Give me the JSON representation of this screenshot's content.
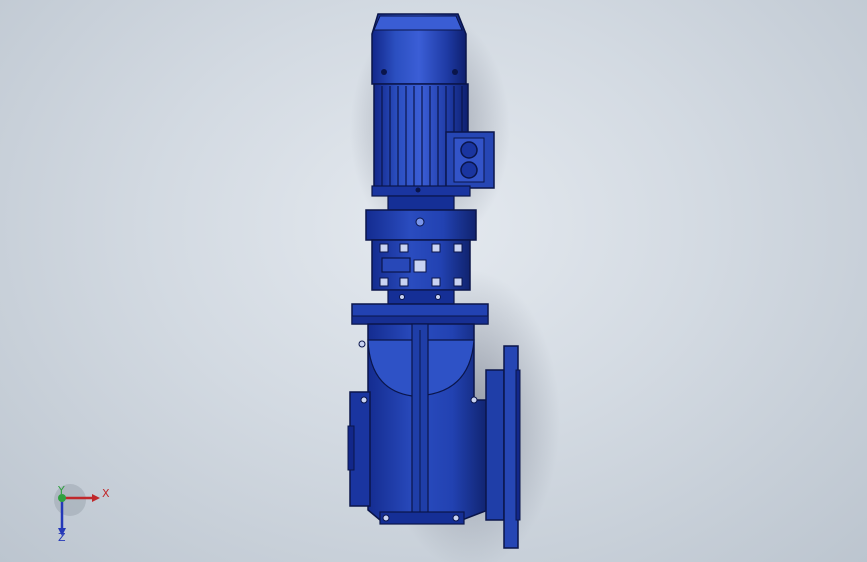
{
  "viewport": {
    "background": [
      "#e4e9ef",
      "#bcc5cf"
    ]
  },
  "model": {
    "name": "gear-motor",
    "colors": {
      "body": "#1f3ea8",
      "body_dark": "#0f2270",
      "body_mid": "#2b4fc0",
      "body_light": "#4d6fdc",
      "highlight": "#7a96ea",
      "outline": "#0a154a",
      "shadow": "#5a6070"
    }
  },
  "triad": {
    "x_label": "X",
    "y_label": "Y",
    "z_label": "Z",
    "x_color": "#c0282b",
    "y_color": "#2fa040",
    "z_color": "#2438b8"
  }
}
